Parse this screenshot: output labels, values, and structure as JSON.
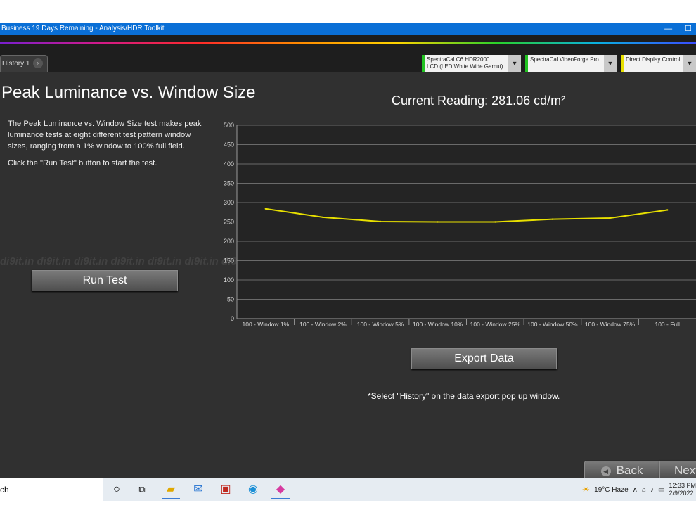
{
  "window": {
    "title": "Business 19 Days Remaining - Analysis/HDR Toolkit",
    "minimize_glyph": "—",
    "maximize_glyph": "☐"
  },
  "tabs": [
    {
      "label": "History 1",
      "close_glyph": "›"
    }
  ],
  "devices": [
    {
      "line1": "SpectraCal C6 HDR2000",
      "line2": "LCD (LED White Wide Gamut)",
      "color": "#22c322"
    },
    {
      "line1": "SpectraCal VideoForge Pro",
      "line2": "",
      "color": "#22c322"
    },
    {
      "line1": "Direct Display Control",
      "line2": "",
      "color": "#e8e000"
    }
  ],
  "main": {
    "title": "Peak Luminance vs. Window Size",
    "description": "The Peak Luminance vs. Window Size test makes peak luminance tests at eight different test pattern window sizes, ranging from a 1% window to 100% full field.",
    "instruction": "Click the \"Run Test\" button to start the test.",
    "run_test_label": "Run Test",
    "current_reading": "Current Reading: 281.06 cd/m²",
    "export_label": "Export  Data",
    "note": "*Select \"History\" on the data export pop up window.",
    "back_label": "Back",
    "next_label": "Next",
    "watermark": "di9it.in  di9it.in  di9it.in  di9it.in  di9it.in  di9it.in  di9it.in  di9it.in  di9it.in  di9it.in  di9it.in  di9it.in  di9it.in  di9it.in  di9it.in  di9it.in  di9it.in"
  },
  "chart_data": {
    "type": "line",
    "categories": [
      "100 - Window  1%",
      "100 - Window  2%",
      "100 - Window  5%",
      "100 - Window 10%",
      "100 - Window 25%",
      "100 - Window 50%",
      "100 - Window 75%",
      "100 - Full"
    ],
    "series": [
      {
        "values": [
          284,
          262,
          251,
          250,
          250,
          257,
          260,
          281
        ],
        "color": "#e8e000"
      }
    ],
    "yticks": [
      0,
      50,
      100,
      150,
      200,
      250,
      300,
      350,
      400,
      450,
      500
    ],
    "ylim": [
      0,
      500
    ],
    "grid": true
  },
  "taskbar": {
    "search_text": "ch",
    "weather": "19°C  Haze",
    "time": "12:33 PM",
    "date": "2/9/2022"
  }
}
